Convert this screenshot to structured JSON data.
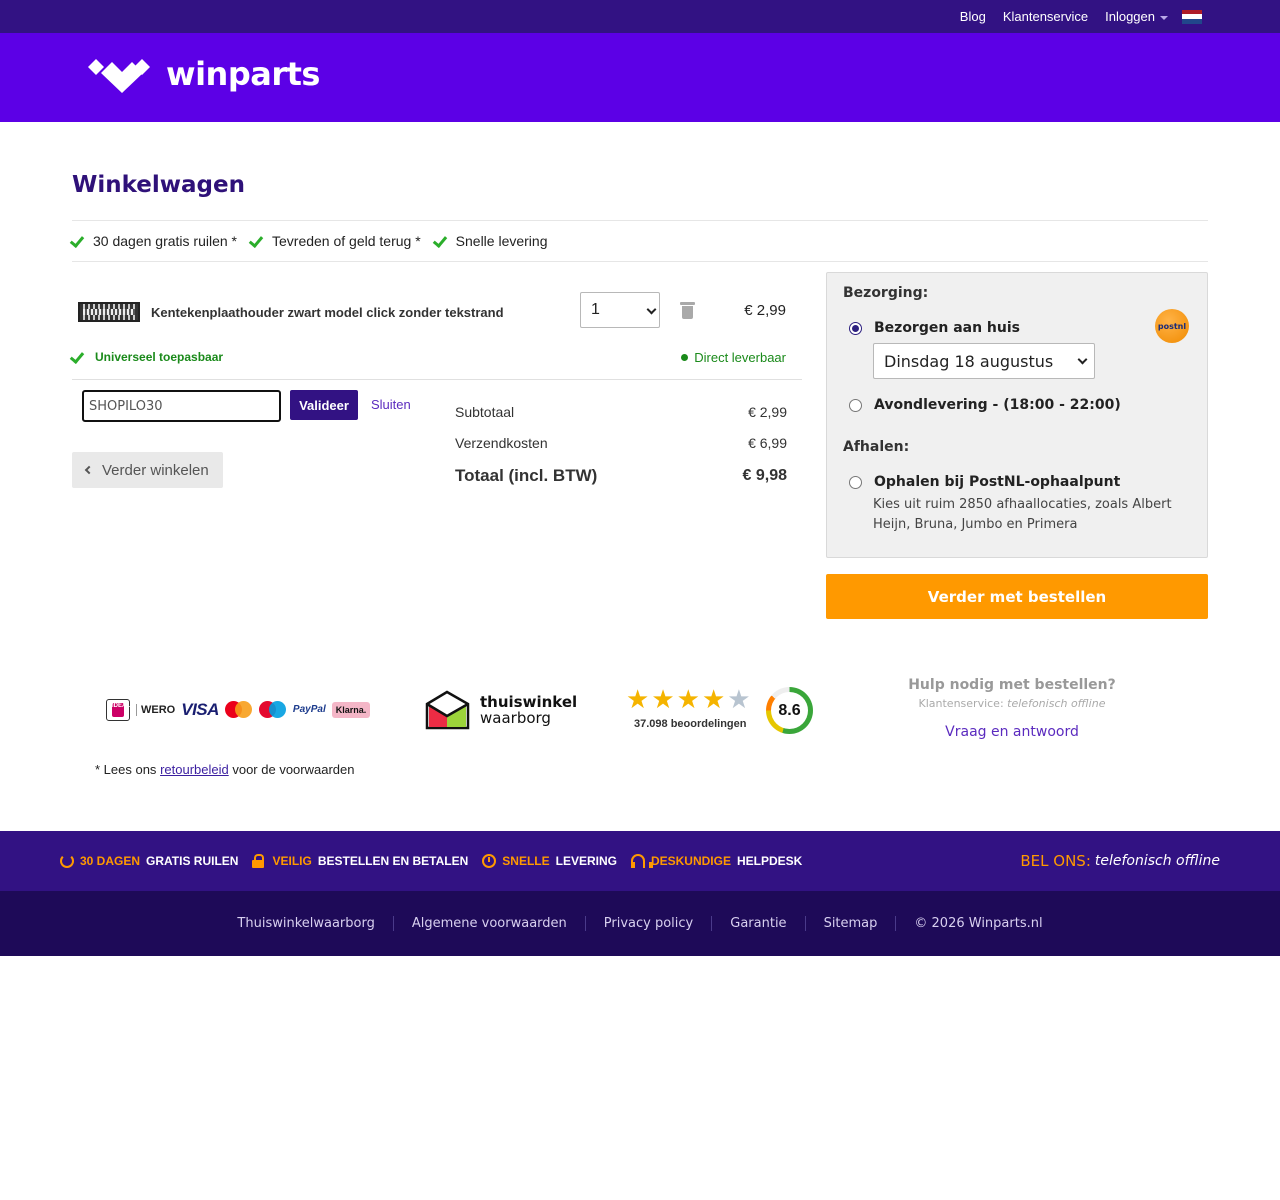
{
  "topnav": {
    "blog": "Blog",
    "customer_service": "Klantenservice",
    "login": "Inloggen",
    "language_flag": "flag-nl"
  },
  "brand": {
    "name": "winparts",
    "primary_color": "#5c00e6",
    "dark_color": "#321283",
    "accent_color": "#ff9900"
  },
  "page": {
    "title": "Winkelwagen"
  },
  "usps": [
    {
      "label": "30 dagen gratis ruilen *"
    },
    {
      "label": "Tevreden of geld terug *"
    },
    {
      "label": "Snelle levering"
    }
  ],
  "cart": {
    "items": [
      {
        "name": "Kentekenplaathouder zwart model click zonder tekstrand",
        "quantity": "1",
        "price": "€  2,99",
        "feature": "Universeel toepasbaar",
        "availability": "Direct leverbaar"
      }
    ],
    "coupon": {
      "value": "SHOPILO30",
      "validate_label": "Valideer",
      "close_label": "Sluiten"
    },
    "continue_shopping": "Verder winkelen",
    "totals": {
      "subtotal_label": "Subtotaal",
      "subtotal_value": "€ 2,99",
      "shipping_label": "Verzendkosten",
      "shipping_value": "€ 6,99",
      "total_label": "Totaal (incl. BTW)",
      "total_value": "€ 9,98"
    }
  },
  "shipping": {
    "delivery_heading": "Bezorging:",
    "home_delivery_label": "Bezorgen aan huis",
    "home_delivery_selected": true,
    "delivery_date": "Dinsdag 18 augustus",
    "evening_label": "Avondlevering - (18:00 - 22:00)",
    "pickup_heading": "Afhalen:",
    "pickup_label": "Ophalen bij PostNL-ophaalpunt",
    "pickup_description": "Kies uit ruim 2850 afhaallocaties, zoals Albert Heijn, Bruna, Jumbo en Primera",
    "carrier_logo_text": "postnl"
  },
  "checkout_button": "Verder met bestellen",
  "trust": {
    "payment_methods": [
      "iDEAL",
      "WERO",
      "VISA",
      "mastercard",
      "maestro",
      "PayPal",
      "Klarna."
    ],
    "twb_line1": "thuiswinkel",
    "twb_line2": "waarborg",
    "stars_filled": 4,
    "stars_total": 5,
    "reviews": "37.098 beoordelingen",
    "score": "8.6"
  },
  "help": {
    "title": "Hulp nodig met bestellen?",
    "subtitle_prefix": "Klantenservice:",
    "subtitle_status": "telefonisch offline",
    "faq_link": "Vraag en antwoord"
  },
  "returns_note": {
    "prefix": "* Lees ons",
    "link": "retourbeleid",
    "suffix": "voor de voorwaarden"
  },
  "footer_usps": [
    {
      "highlight": "30 DAGEN",
      "text": "GRATIS RUILEN",
      "icon": "refresh-icon"
    },
    {
      "highlight": "VEILIG",
      "text": "BESTELLEN EN BETALEN",
      "icon": "lock-icon"
    },
    {
      "highlight": "SNELLE",
      "text": "LEVERING",
      "icon": "timer-icon"
    },
    {
      "highlight": "DESKUNDIGE",
      "text": "HELPDESK",
      "icon": "headset-icon"
    }
  ],
  "call_us": {
    "label": "BEL ONS:",
    "status": "telefonisch offline"
  },
  "footer_links": [
    "Thuiswinkelwaarborg",
    "Algemene voorwaarden",
    "Privacy policy",
    "Garantie",
    "Sitemap",
    "© 2026 Winparts.nl"
  ]
}
